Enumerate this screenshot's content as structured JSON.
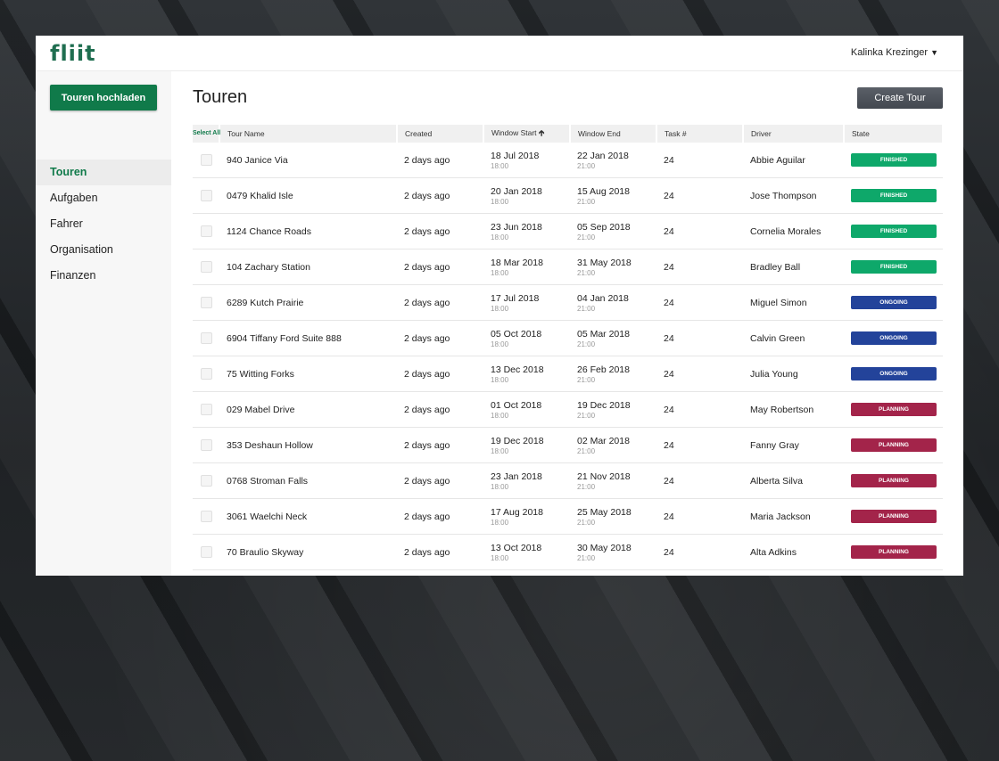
{
  "app": {
    "logo": "fliit",
    "user_name": "Kalinka Krezinger"
  },
  "sidebar": {
    "upload_label": "Touren hochladen",
    "items": [
      {
        "label": "Touren",
        "active": true
      },
      {
        "label": "Aufgaben",
        "active": false
      },
      {
        "label": "Fahrer",
        "active": false
      },
      {
        "label": "Organisation",
        "active": false
      },
      {
        "label": "Finanzen",
        "active": false
      }
    ]
  },
  "main": {
    "title": "Touren",
    "create_label": "Create Tour"
  },
  "table": {
    "select_all_label": "Select All",
    "sort_indicator": "up-arrow-icon",
    "columns": [
      "Tour Name",
      "Created",
      "Window Start",
      "Window End",
      "Task #",
      "Driver",
      "State"
    ],
    "state_colors": {
      "FINISHED": "#0ea86a",
      "ONGOING": "#23439a",
      "PLANNING": "#a3244a"
    },
    "rows": [
      {
        "name": "940 Janice Via",
        "created": "2 days ago",
        "start": "18 Jul 2018",
        "start_time": "18:00",
        "end": "22 Jan 2018",
        "end_time": "21:00",
        "tasks": "24",
        "driver": "Abbie Aguilar",
        "state": "FINISHED"
      },
      {
        "name": "0479 Khalid Isle",
        "created": "2 days ago",
        "start": "20 Jan 2018",
        "start_time": "18:00",
        "end": "15 Aug 2018",
        "end_time": "21:00",
        "tasks": "24",
        "driver": "Jose Thompson",
        "state": "FINISHED"
      },
      {
        "name": "1124 Chance Roads",
        "created": "2 days ago",
        "start": "23 Jun 2018",
        "start_time": "18:00",
        "end": "05 Sep 2018",
        "end_time": "21:00",
        "tasks": "24",
        "driver": "Cornelia Morales",
        "state": "FINISHED"
      },
      {
        "name": "104 Zachary Station",
        "created": "2 days ago",
        "start": "18 Mar 2018",
        "start_time": "18:00",
        "end": "31 May 2018",
        "end_time": "21:00",
        "tasks": "24",
        "driver": "Bradley Ball",
        "state": "FINISHED"
      },
      {
        "name": "6289 Kutch Prairie",
        "created": "2 days ago",
        "start": "17 Jul 2018",
        "start_time": "18:00",
        "end": "04 Jan 2018",
        "end_time": "21:00",
        "tasks": "24",
        "driver": "Miguel Simon",
        "state": "ONGOING"
      },
      {
        "name": "6904 Tiffany Ford Suite 888",
        "created": "2 days ago",
        "start": "05 Oct 2018",
        "start_time": "18:00",
        "end": "05 Mar 2018",
        "end_time": "21:00",
        "tasks": "24",
        "driver": "Calvin Green",
        "state": "ONGOING"
      },
      {
        "name": "75 Witting Forks",
        "created": "2 days ago",
        "start": "13 Dec 2018",
        "start_time": "18:00",
        "end": "26 Feb 2018",
        "end_time": "21:00",
        "tasks": "24",
        "driver": "Julia Young",
        "state": "ONGOING"
      },
      {
        "name": "029 Mabel Drive",
        "created": "2 days ago",
        "start": "01 Oct 2018",
        "start_time": "18:00",
        "end": "19 Dec 2018",
        "end_time": "21:00",
        "tasks": "24",
        "driver": "May Robertson",
        "state": "PLANNING"
      },
      {
        "name": "353 Deshaun Hollow",
        "created": "2 days ago",
        "start": "19 Dec 2018",
        "start_time": "18:00",
        "end": "02 Mar 2018",
        "end_time": "21:00",
        "tasks": "24",
        "driver": "Fanny Gray",
        "state": "PLANNING"
      },
      {
        "name": "0768 Stroman Falls",
        "created": "2 days ago",
        "start": "23 Jan 2018",
        "start_time": "18:00",
        "end": "21 Nov 2018",
        "end_time": "21:00",
        "tasks": "24",
        "driver": "Alberta Silva",
        "state": "PLANNING"
      },
      {
        "name": "3061 Waelchi Neck",
        "created": "2 days ago",
        "start": "17 Aug 2018",
        "start_time": "18:00",
        "end": "25 May 2018",
        "end_time": "21:00",
        "tasks": "24",
        "driver": "Maria Jackson",
        "state": "PLANNING"
      },
      {
        "name": "70 Braulio Skyway",
        "created": "2 days ago",
        "start": "13 Oct 2018",
        "start_time": "18:00",
        "end": "30 May 2018",
        "end_time": "21:00",
        "tasks": "24",
        "driver": "Alta Adkins",
        "state": "PLANNING"
      }
    ]
  }
}
